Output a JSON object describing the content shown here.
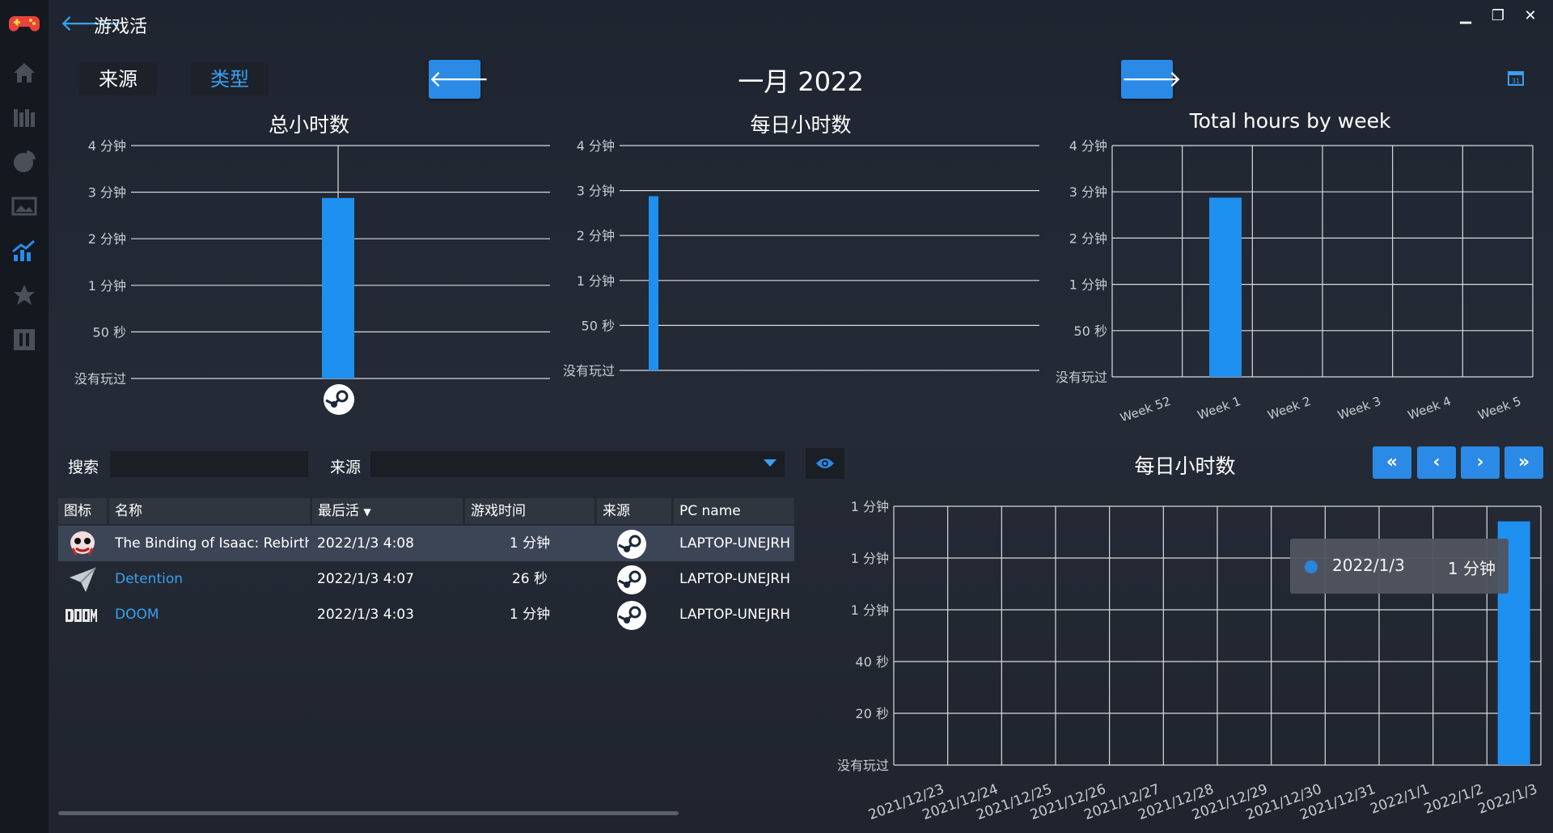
{
  "app": {
    "title": "游戏活"
  },
  "window_controls": {
    "minimize": "▁",
    "restore": "❐",
    "close": "✕"
  },
  "tabs": {
    "source": "来源",
    "type": "类型"
  },
  "header": {
    "month": "一月 2022"
  },
  "colors": {
    "accent": "#2a8ae6",
    "bar": "#1e90f0",
    "link": "#3aa0f0"
  },
  "search": {
    "label": "搜索",
    "value": ""
  },
  "source_filter": {
    "label": "来源",
    "value": ""
  },
  "table": {
    "headers": [
      "图标",
      "名称",
      "最后活",
      "游戏时间",
      "来源",
      "PC name"
    ],
    "rows": [
      {
        "name": "The Binding of Isaac: Rebirth",
        "last": "2022/1/3 4:08",
        "time": "1 分钟",
        "pc": "LAPTOP-UNEJRH",
        "icon": "isaac-icon",
        "selected": true
      },
      {
        "name": "Detention",
        "last": "2022/1/3 4:07",
        "time": "26 秒",
        "pc": "LAPTOP-UNEJRH",
        "icon": "paper-plane-icon",
        "selected": false
      },
      {
        "name": "DOOM",
        "last": "2022/1/3 4:03",
        "time": "1 分钟",
        "pc": "LAPTOP-UNEJRH",
        "icon": "doom-logo-icon",
        "selected": false
      }
    ]
  },
  "tooltip": {
    "date": "2022/1/3",
    "value": "1 分钟"
  },
  "pager": {
    "first": "«",
    "prev": "‹",
    "next": "›",
    "last": "»"
  },
  "chart_data": [
    {
      "type": "bar",
      "title": "总小时数",
      "categories": [
        "Steam"
      ],
      "values": [
        3.1
      ],
      "yunit": "minutes",
      "ylim": [
        0,
        4
      ],
      "yticks": [
        0,
        0.83,
        2,
        3,
        4,
        1
      ],
      "ytick_labels": [
        "没有玩过",
        "50 秒",
        "1 分钟",
        "2 分钟",
        "3 分钟",
        "4 分钟"
      ],
      "grid": true
    },
    {
      "type": "bar",
      "title": "每日小时数",
      "values": [
        3.1
      ],
      "yunit": "minutes",
      "ylim": [
        0,
        4
      ],
      "ytick_labels": [
        "没有玩过",
        "50 秒",
        "1 分钟",
        "2 分钟",
        "3 分钟",
        "4 分钟"
      ],
      "grid": true
    },
    {
      "type": "bar",
      "title": "Total hours by week",
      "categories": [
        "Week 52",
        "Week 1",
        "Week 2",
        "Week 3",
        "Week 4",
        "Week 5"
      ],
      "values": [
        0,
        3.1,
        0,
        0,
        0,
        0
      ],
      "yunit": "minutes",
      "ylim": [
        0,
        4
      ],
      "ytick_labels": [
        "没有玩过",
        "50 秒",
        "1 分钟",
        "2 分钟",
        "3 分钟",
        "4 分钟"
      ],
      "grid": true
    },
    {
      "type": "bar",
      "title": "每日小时数",
      "categories": [
        "2021/12/23",
        "2021/12/24",
        "2021/12/25",
        "2021/12/26",
        "2021/12/27",
        "2021/12/28",
        "2021/12/29",
        "2021/12/30",
        "2021/12/31",
        "2022/1/1",
        "2022/1/2",
        "2022/1/3"
      ],
      "values": [
        0,
        0,
        0,
        0,
        0,
        0,
        0,
        0,
        0,
        0,
        0,
        1.13
      ],
      "yunit": "minutes",
      "ylim": [
        0,
        1.2
      ],
      "ytick_labels": [
        "没有玩过",
        "20 秒",
        "40 秒",
        "1 分钟",
        "1 分钟",
        "1 分钟"
      ],
      "grid": true
    }
  ]
}
